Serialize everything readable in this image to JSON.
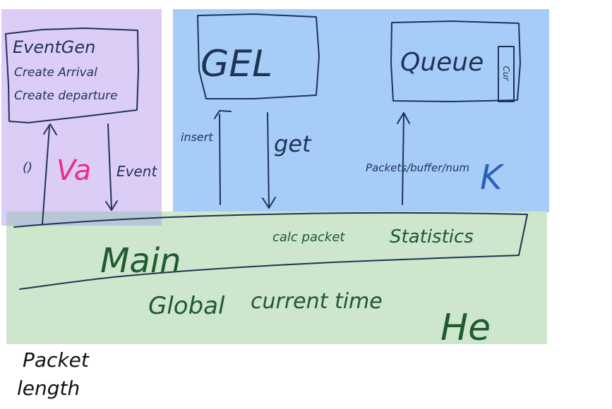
{
  "colors": {
    "purple_zone": "#dccdf6",
    "blue_zone": "#a6cdf8",
    "green_zone": "#cde6cc",
    "overlap_zone": "#b9c6d8",
    "ink_dark": "#1f3355",
    "ink_green": "#1f5a30",
    "ink_pink": "#ee2a8d",
    "ink_blue": "#2b5fb8",
    "ink_black": "#111111"
  },
  "zones": {
    "va": {
      "label": "Va"
    },
    "k": {
      "label": "K"
    },
    "he": {
      "label": "He"
    }
  },
  "eventgen": {
    "lines": [
      "EventGen",
      "Create Arrival",
      "Create departure"
    ]
  },
  "gel": {
    "label": "GEL"
  },
  "queue": {
    "label": "Queue",
    "cur_box": "Cur"
  },
  "arrows": {
    "paren": "()",
    "event": "Event",
    "insert": "insert",
    "get": "get",
    "packets": "Packets/buffer/num"
  },
  "main": {
    "label": "Main",
    "calc": "calc packet",
    "statistics": "Statistics",
    "global": "Global",
    "current_time": "current time"
  },
  "notes": {
    "packet": "Packet",
    "length": "length"
  }
}
